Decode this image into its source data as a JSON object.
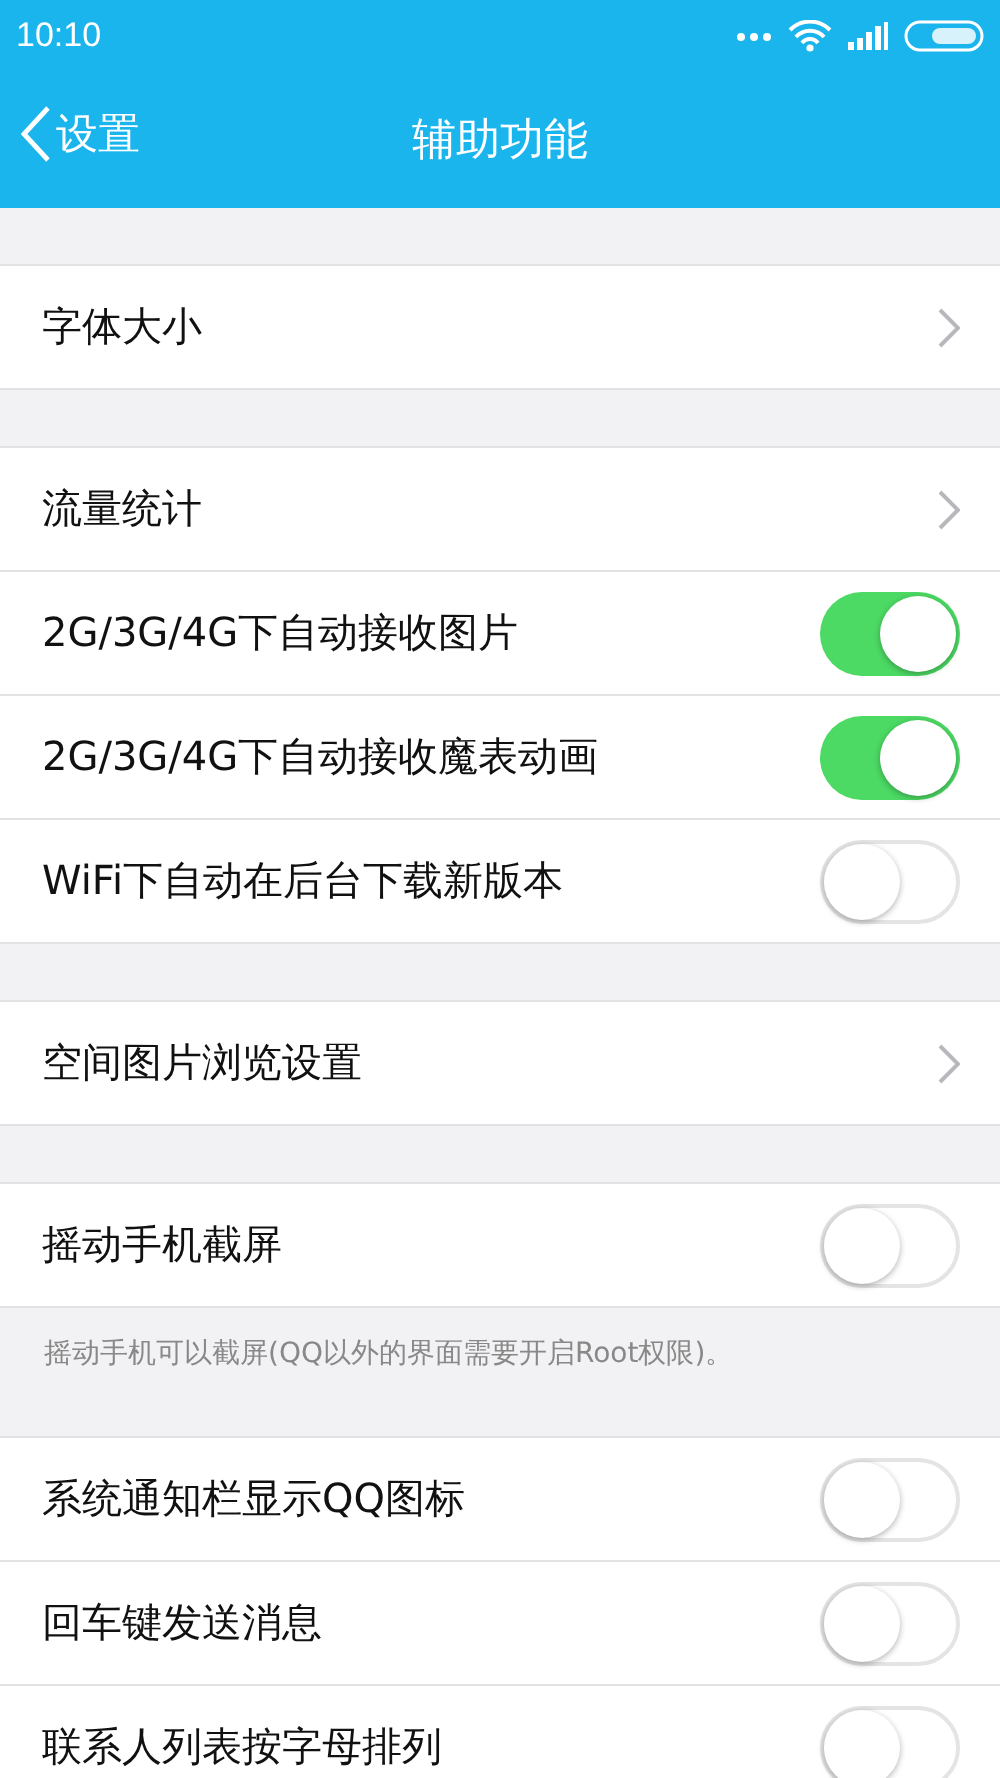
{
  "status_bar": {
    "time": "10:10"
  },
  "nav": {
    "back_label": "设置",
    "title": "辅助功能"
  },
  "sections": [
    {
      "rows": [
        {
          "kind": "link",
          "label": "字体大小"
        }
      ]
    },
    {
      "rows": [
        {
          "kind": "link",
          "label": "流量统计"
        },
        {
          "kind": "toggle",
          "label": "2G/3G/4G下自动接收图片",
          "on": true
        },
        {
          "kind": "toggle",
          "label": "2G/3G/4G下自动接收魔表动画",
          "on": true
        },
        {
          "kind": "toggle",
          "label": "WiFi下自动在后台下载新版本",
          "on": false
        }
      ]
    },
    {
      "rows": [
        {
          "kind": "link",
          "label": "空间图片浏览设置"
        }
      ]
    },
    {
      "rows": [
        {
          "kind": "toggle",
          "label": "摇动手机截屏",
          "on": false
        }
      ],
      "note": "摇动手机可以截屏(QQ以外的界面需要开启Root权限)。"
    },
    {
      "rows": [
        {
          "kind": "toggle",
          "label": "系统通知栏显示QQ图标",
          "on": false
        },
        {
          "kind": "toggle",
          "label": "回车键发送消息",
          "on": false
        },
        {
          "kind": "toggle",
          "label": "联系人列表按字母排列",
          "on": false
        }
      ]
    }
  ]
}
